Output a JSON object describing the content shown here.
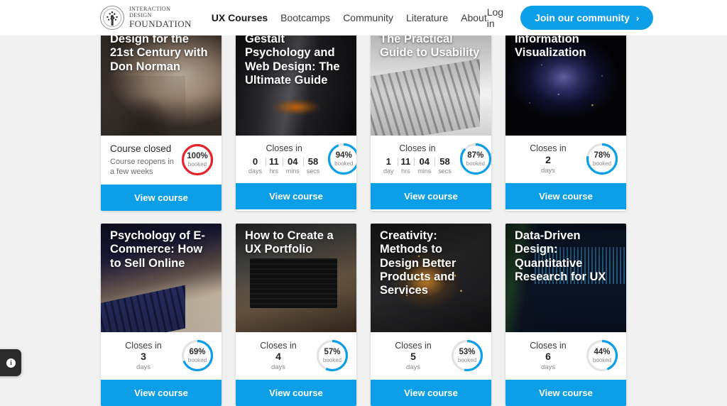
{
  "header": {
    "logo": {
      "line1": "INTERACTION DESIGN",
      "line2": "FOUNDATION",
      "icon": "tree-emblem-icon"
    },
    "nav": [
      {
        "label": "UX Courses",
        "active": true
      },
      {
        "label": "Bootcamps",
        "active": false
      },
      {
        "label": "Community",
        "active": false
      },
      {
        "label": "Literature",
        "active": false
      },
      {
        "label": "About",
        "active": false
      }
    ],
    "login_label": "Log in",
    "join_label": "Join our community",
    "join_chevron": "›"
  },
  "colors": {
    "accent_blue": "#0d9ee8",
    "alert_red": "#e8232a",
    "ring_track": "#e3e3e3",
    "page_bg": "#f1f1f1",
    "card_bg": "#ffffff"
  },
  "cards": [
    {
      "title": "Design for the 21st Century with Don Norman",
      "image": "ph-donnorman",
      "status_type": "closed",
      "closed_title": "Course closed",
      "closed_sub": "Course reopens in a few weeks",
      "percent": 100,
      "percent_label": "100%",
      "booked_label": "booked",
      "ring_color": "#e8232a",
      "button_label": "View course"
    },
    {
      "title": "Gestalt Psychology and Web Design: The Ultimate Guide",
      "image": "ph-gestalt",
      "status_type": "countdown",
      "closes_label": "Closes in",
      "countdown": [
        {
          "value": "0",
          "unit": "days"
        },
        {
          "value": "11",
          "unit": "hrs"
        },
        {
          "value": "04",
          "unit": "mins"
        },
        {
          "value": "58",
          "unit": "secs"
        }
      ],
      "percent": 94,
      "percent_label": "94%",
      "booked_label": "booked",
      "ring_color": "#0d9ee8",
      "button_label": "View course"
    },
    {
      "title": "The Practical Guide to Usability",
      "image": "ph-usability",
      "status_type": "countdown",
      "closes_label": "Closes in",
      "countdown": [
        {
          "value": "1",
          "unit": "day"
        },
        {
          "value": "11",
          "unit": "hrs"
        },
        {
          "value": "04",
          "unit": "mins"
        },
        {
          "value": "58",
          "unit": "secs"
        }
      ],
      "percent": 87,
      "percent_label": "87%",
      "booked_label": "booked",
      "ring_color": "#0d9ee8",
      "button_label": "View course"
    },
    {
      "title": "Information Visualization",
      "image": "ph-infoviz",
      "status_type": "days",
      "closes_label": "Closes in",
      "days_value": "2",
      "days_unit": "days",
      "percent": 78,
      "percent_label": "78%",
      "booked_label": "booked",
      "ring_color": "#0d9ee8",
      "button_label": "View course"
    },
    {
      "title": "Psychology of E-Commerce: How to Sell Online",
      "image": "ph-ecommerce",
      "status_type": "days",
      "closes_label": "Closes in",
      "days_value": "3",
      "days_unit": "days",
      "percent": 69,
      "percent_label": "69%",
      "booked_label": "booked",
      "ring_color": "#0d9ee8",
      "button_label": "View course"
    },
    {
      "title": "How to Create a UX Portfolio",
      "image": "ph-portfolio",
      "status_type": "days",
      "closes_label": "Closes in",
      "days_value": "4",
      "days_unit": "days",
      "percent": 57,
      "percent_label": "57%",
      "booked_label": "booked",
      "ring_color": "#0d9ee8",
      "button_label": "View course"
    },
    {
      "title": "Creativity: Methods to Design Better Products and Services",
      "image": "ph-creativity",
      "status_type": "days",
      "closes_label": "Closes in",
      "days_value": "5",
      "days_unit": "days",
      "percent": 53,
      "percent_label": "53%",
      "booked_label": "booked",
      "ring_color": "#0d9ee8",
      "button_label": "View course"
    },
    {
      "title": "Data-Driven Design: Quantitative Research for UX",
      "image": "ph-datadriven",
      "status_type": "days",
      "closes_label": "Closes in",
      "days_value": "6",
      "days_unit": "days",
      "percent": 44,
      "percent_label": "44%",
      "booked_label": "booked",
      "ring_color": "#0d9ee8",
      "button_label": "View course"
    }
  ],
  "cookie_badge": {
    "icon": "info-cookie-icon",
    "glyph": "i"
  }
}
